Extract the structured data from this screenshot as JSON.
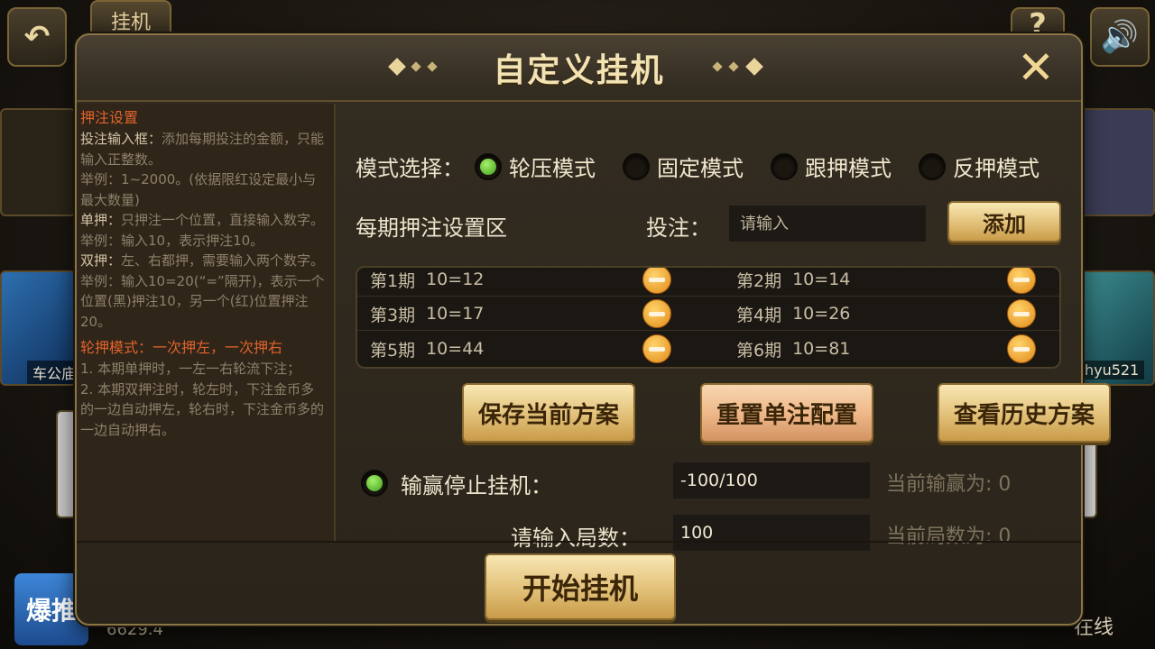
{
  "background": {
    "tag_label": "挂机",
    "left_player_name": "车公庙",
    "right_player_name": "hyu521",
    "banner_text": "爆推",
    "coins": "6629.4",
    "online_label": "在线"
  },
  "dialog": {
    "title": "自定义挂机",
    "close_icon": "close-icon"
  },
  "help": {
    "section_title": "押注设置",
    "lines": [
      {
        "key": "投注输入框：",
        "text": "添加每期投注的金额，只能输入正整数。"
      },
      {
        "key": "",
        "text": "举例：1~2000。(依据限红设定最小与最大数量)"
      },
      {
        "key": "单押：",
        "text": "只押注一个位置，直接输入数字。"
      },
      {
        "key": "",
        "text": "举例：输入10，表示押注10。"
      },
      {
        "key": "双押：",
        "text": "左、右都押，需要输入两个数字。"
      },
      {
        "key": "",
        "text": "举例：输入10=20(“=”隔开)，表示一个位置(黑)押注10，另一个(红)位置押注20。"
      }
    ],
    "mode_title": "轮押模式：一次押左，一次押右",
    "mode_lines": [
      "1. 本期单押时，一左一右轮流下注；",
      "2. 本期双押注时，轮左时，下注金币多的一边自动押左，轮右时，下注金币多的一边自动押右。"
    ]
  },
  "mode": {
    "label": "模式选择：",
    "options": [
      {
        "label": "轮压模式",
        "selected": true
      },
      {
        "label": "固定模式",
        "selected": false
      },
      {
        "label": "跟押模式",
        "selected": false
      },
      {
        "label": "反押模式",
        "selected": false
      }
    ]
  },
  "bet": {
    "zone_label": "每期押注设置区",
    "bet_label": "投注：",
    "placeholder": "请输入",
    "add_label": "添加"
  },
  "periods": [
    {
      "label": "第1期",
      "value": "10=12"
    },
    {
      "label": "第2期",
      "value": "10=14"
    },
    {
      "label": "第3期",
      "value": "10=17"
    },
    {
      "label": "第4期",
      "value": "10=26"
    },
    {
      "label": "第5期",
      "value": "10=44"
    },
    {
      "label": "第6期",
      "value": "10=81"
    }
  ],
  "actions": {
    "save": "保存当前方案",
    "reset": "重置单注配置",
    "history": "查看历史方案"
  },
  "stop": {
    "enabled": true,
    "label": "输赢停止挂机：",
    "value": "-100/100",
    "status": "当前输赢为: 0"
  },
  "rounds": {
    "label": "请输入局数：",
    "value": "100",
    "status": "当前局数为: 0"
  },
  "start_label": "开始挂机",
  "colors": {
    "accent_gold": "#e4c47d",
    "radio_on": "#3da11d",
    "help_heading": "#e0632c"
  }
}
